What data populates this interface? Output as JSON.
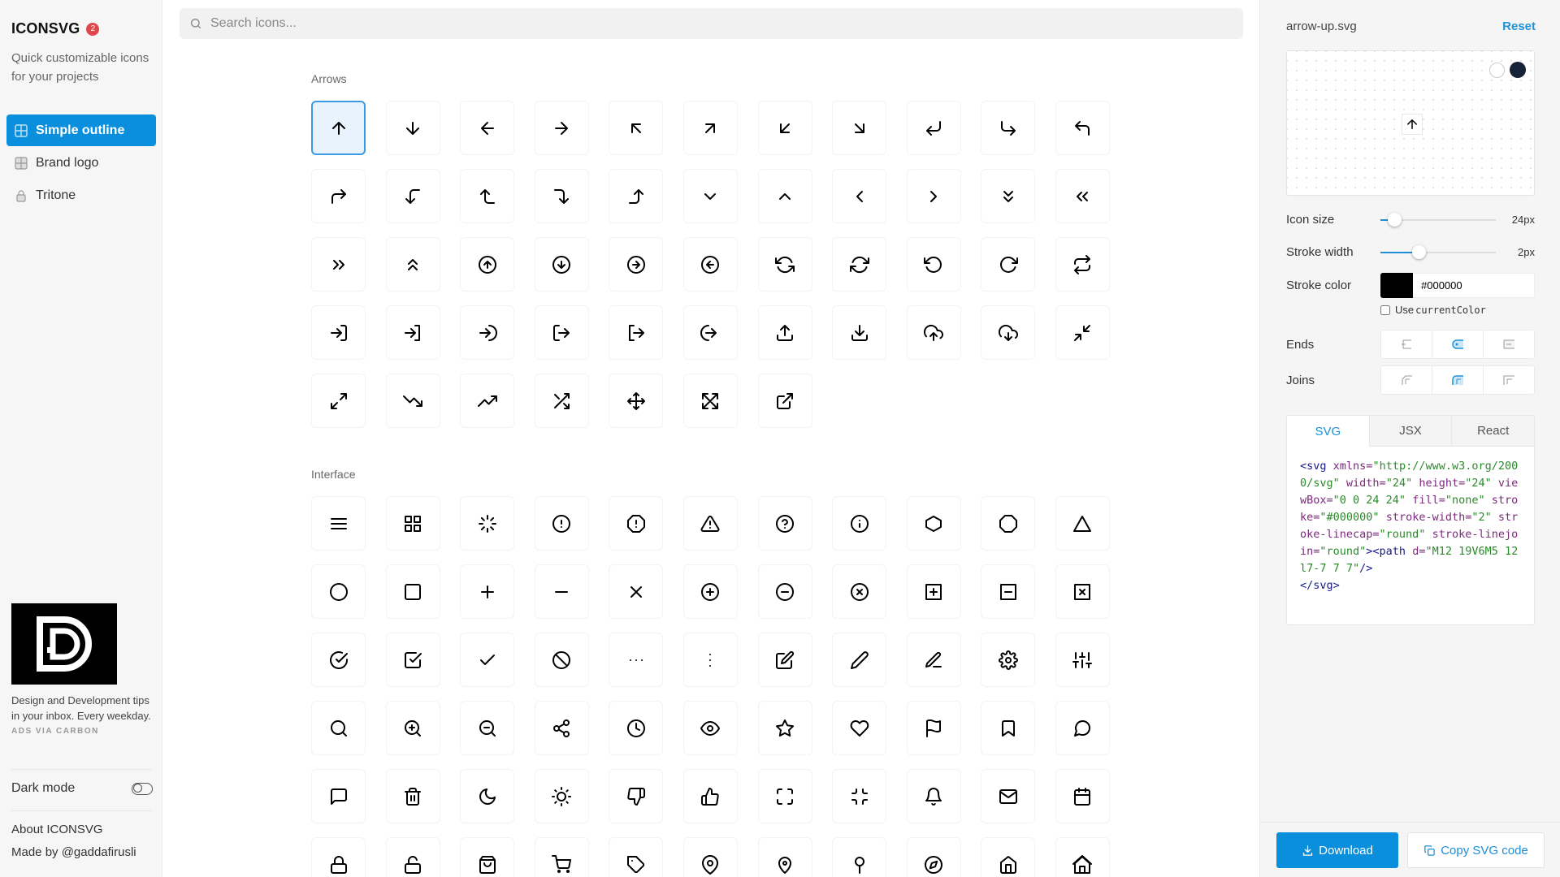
{
  "sidebar": {
    "title": "ICONSVG",
    "badge": "2",
    "tagline": "Quick customizable icons for your projects",
    "nav": [
      {
        "label": "Simple outline",
        "icon": "grid-icon",
        "active": true
      },
      {
        "label": "Brand logo",
        "icon": "grid-icon",
        "active": false
      },
      {
        "label": "Tritone",
        "icon": "lock-icon",
        "active": false
      }
    ],
    "ad": {
      "text": "Design and Development tips in your inbox. Every weekday.",
      "via": "ADS VIA CARBON"
    },
    "dark_mode_label": "Dark mode",
    "dark_mode_on": false,
    "about": "About ICONSVG",
    "made_by": "Made by @gaddafirusli"
  },
  "search": {
    "placeholder": "Search icons...",
    "value": ""
  },
  "sections": [
    {
      "label": "Arrows",
      "icons": [
        "arrow-up",
        "arrow-down",
        "arrow-left",
        "arrow-right",
        "arrow-up-left",
        "arrow-up-right",
        "arrow-down-left",
        "arrow-down-right",
        "corner-down-left",
        "corner-down-right",
        "corner-up-left",
        "corner-up-right",
        "corner-left-down",
        "corner-left-up",
        "corner-right-down",
        "corner-right-up",
        "chevron-down",
        "chevron-up",
        "chevron-left",
        "chevron-right",
        "chevrons-down",
        "chevrons-left",
        "chevrons-right",
        "chevrons-up",
        "arrow-up-circle",
        "arrow-down-circle",
        "arrow-right-circle",
        "arrow-left-circle",
        "refresh-ccw",
        "refresh-cw",
        "rotate-ccw",
        "rotate-cw",
        "repeat",
        "log-in",
        "log-in-2",
        "log-in-circle",
        "log-out",
        "log-out-2",
        "log-out-circle",
        "upload",
        "download",
        "upload-cloud",
        "download-cloud",
        "minimize-2",
        "maximize-2",
        "trending-down",
        "trending-up",
        "shuffle",
        "move",
        "expand",
        "external-link"
      ]
    },
    {
      "label": "Interface",
      "icons": [
        "menu",
        "grid",
        "loader",
        "alert-circle",
        "alert-octagon",
        "alert-triangle",
        "help-circle",
        "info",
        "hexagon",
        "octagon",
        "triangle",
        "circle",
        "square",
        "plus",
        "minus",
        "x",
        "plus-circle",
        "minus-circle",
        "x-circle",
        "plus-square",
        "minus-square",
        "x-square",
        "check-circle",
        "check-square",
        "check",
        "slash",
        "more-horizontal",
        "more-vertical",
        "edit",
        "edit-2",
        "edit-3",
        "settings",
        "sliders",
        "search",
        "zoom-in",
        "zoom-out",
        "share",
        "clock",
        "eye",
        "star",
        "heart",
        "flag",
        "bookmark",
        "message-circle",
        "message-square",
        "trash",
        "moon",
        "sun",
        "thumbs-down",
        "thumbs-up",
        "maximize",
        "minimize",
        "bell",
        "mail",
        "calendar",
        "lock",
        "unlock",
        "shopping-bag",
        "shopping-cart",
        "tag",
        "map-pin",
        "map-pin-2",
        "pin",
        "compass",
        "home",
        "home-2"
      ]
    }
  ],
  "selected_icon": "arrow-up",
  "panel": {
    "filename": "arrow-up.svg",
    "reset_label": "Reset",
    "preview_bg_options": [
      "white",
      "dark"
    ],
    "icon_size_label": "Icon size",
    "icon_size_value": "24px",
    "icon_size_fraction": 0.12,
    "stroke_width_label": "Stroke width",
    "stroke_width_value": "2px",
    "stroke_width_fraction": 0.33,
    "stroke_color_label": "Stroke color",
    "stroke_color_value": "#000000",
    "use_current_color_prefix": "Use ",
    "use_current_color_code": "currentColor",
    "use_current_color_checked": false,
    "ends_label": "Ends",
    "ends_options": [
      "butt",
      "round",
      "square"
    ],
    "ends_selected": "round",
    "joins_label": "Joins",
    "joins_options": [
      "miter",
      "round",
      "bevel"
    ],
    "joins_selected": "round",
    "tabs": [
      "SVG",
      "JSX",
      "React"
    ],
    "active_tab": "SVG",
    "code_path": "M12 19V6M5 12l7-7 7 7",
    "download_label": "Download",
    "copy_label": "Copy SVG code",
    "accent": "#0a8fdc"
  }
}
